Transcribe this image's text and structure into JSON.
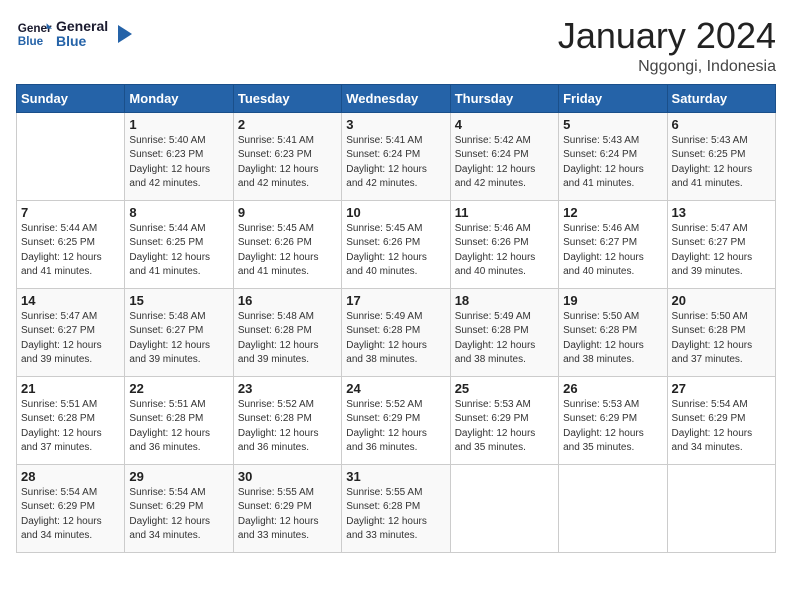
{
  "header": {
    "logo_general": "General",
    "logo_blue": "Blue",
    "title": "January 2024",
    "subtitle": "Nggongi, Indonesia"
  },
  "weekdays": [
    "Sunday",
    "Monday",
    "Tuesday",
    "Wednesday",
    "Thursday",
    "Friday",
    "Saturday"
  ],
  "weeks": [
    [
      {
        "day": "",
        "info": ""
      },
      {
        "day": "1",
        "info": "Sunrise: 5:40 AM\nSunset: 6:23 PM\nDaylight: 12 hours\nand 42 minutes."
      },
      {
        "day": "2",
        "info": "Sunrise: 5:41 AM\nSunset: 6:23 PM\nDaylight: 12 hours\nand 42 minutes."
      },
      {
        "day": "3",
        "info": "Sunrise: 5:41 AM\nSunset: 6:24 PM\nDaylight: 12 hours\nand 42 minutes."
      },
      {
        "day": "4",
        "info": "Sunrise: 5:42 AM\nSunset: 6:24 PM\nDaylight: 12 hours\nand 42 minutes."
      },
      {
        "day": "5",
        "info": "Sunrise: 5:43 AM\nSunset: 6:24 PM\nDaylight: 12 hours\nand 41 minutes."
      },
      {
        "day": "6",
        "info": "Sunrise: 5:43 AM\nSunset: 6:25 PM\nDaylight: 12 hours\nand 41 minutes."
      }
    ],
    [
      {
        "day": "7",
        "info": "Sunrise: 5:44 AM\nSunset: 6:25 PM\nDaylight: 12 hours\nand 41 minutes."
      },
      {
        "day": "8",
        "info": "Sunrise: 5:44 AM\nSunset: 6:25 PM\nDaylight: 12 hours\nand 41 minutes."
      },
      {
        "day": "9",
        "info": "Sunrise: 5:45 AM\nSunset: 6:26 PM\nDaylight: 12 hours\nand 41 minutes."
      },
      {
        "day": "10",
        "info": "Sunrise: 5:45 AM\nSunset: 6:26 PM\nDaylight: 12 hours\nand 40 minutes."
      },
      {
        "day": "11",
        "info": "Sunrise: 5:46 AM\nSunset: 6:26 PM\nDaylight: 12 hours\nand 40 minutes."
      },
      {
        "day": "12",
        "info": "Sunrise: 5:46 AM\nSunset: 6:27 PM\nDaylight: 12 hours\nand 40 minutes."
      },
      {
        "day": "13",
        "info": "Sunrise: 5:47 AM\nSunset: 6:27 PM\nDaylight: 12 hours\nand 39 minutes."
      }
    ],
    [
      {
        "day": "14",
        "info": "Sunrise: 5:47 AM\nSunset: 6:27 PM\nDaylight: 12 hours\nand 39 minutes."
      },
      {
        "day": "15",
        "info": "Sunrise: 5:48 AM\nSunset: 6:27 PM\nDaylight: 12 hours\nand 39 minutes."
      },
      {
        "day": "16",
        "info": "Sunrise: 5:48 AM\nSunset: 6:28 PM\nDaylight: 12 hours\nand 39 minutes."
      },
      {
        "day": "17",
        "info": "Sunrise: 5:49 AM\nSunset: 6:28 PM\nDaylight: 12 hours\nand 38 minutes."
      },
      {
        "day": "18",
        "info": "Sunrise: 5:49 AM\nSunset: 6:28 PM\nDaylight: 12 hours\nand 38 minutes."
      },
      {
        "day": "19",
        "info": "Sunrise: 5:50 AM\nSunset: 6:28 PM\nDaylight: 12 hours\nand 38 minutes."
      },
      {
        "day": "20",
        "info": "Sunrise: 5:50 AM\nSunset: 6:28 PM\nDaylight: 12 hours\nand 37 minutes."
      }
    ],
    [
      {
        "day": "21",
        "info": "Sunrise: 5:51 AM\nSunset: 6:28 PM\nDaylight: 12 hours\nand 37 minutes."
      },
      {
        "day": "22",
        "info": "Sunrise: 5:51 AM\nSunset: 6:28 PM\nDaylight: 12 hours\nand 36 minutes."
      },
      {
        "day": "23",
        "info": "Sunrise: 5:52 AM\nSunset: 6:28 PM\nDaylight: 12 hours\nand 36 minutes."
      },
      {
        "day": "24",
        "info": "Sunrise: 5:52 AM\nSunset: 6:29 PM\nDaylight: 12 hours\nand 36 minutes."
      },
      {
        "day": "25",
        "info": "Sunrise: 5:53 AM\nSunset: 6:29 PM\nDaylight: 12 hours\nand 35 minutes."
      },
      {
        "day": "26",
        "info": "Sunrise: 5:53 AM\nSunset: 6:29 PM\nDaylight: 12 hours\nand 35 minutes."
      },
      {
        "day": "27",
        "info": "Sunrise: 5:54 AM\nSunset: 6:29 PM\nDaylight: 12 hours\nand 34 minutes."
      }
    ],
    [
      {
        "day": "28",
        "info": "Sunrise: 5:54 AM\nSunset: 6:29 PM\nDaylight: 12 hours\nand 34 minutes."
      },
      {
        "day": "29",
        "info": "Sunrise: 5:54 AM\nSunset: 6:29 PM\nDaylight: 12 hours\nand 34 minutes."
      },
      {
        "day": "30",
        "info": "Sunrise: 5:55 AM\nSunset: 6:29 PM\nDaylight: 12 hours\nand 33 minutes."
      },
      {
        "day": "31",
        "info": "Sunrise: 5:55 AM\nSunset: 6:28 PM\nDaylight: 12 hours\nand 33 minutes."
      },
      {
        "day": "",
        "info": ""
      },
      {
        "day": "",
        "info": ""
      },
      {
        "day": "",
        "info": ""
      }
    ]
  ]
}
